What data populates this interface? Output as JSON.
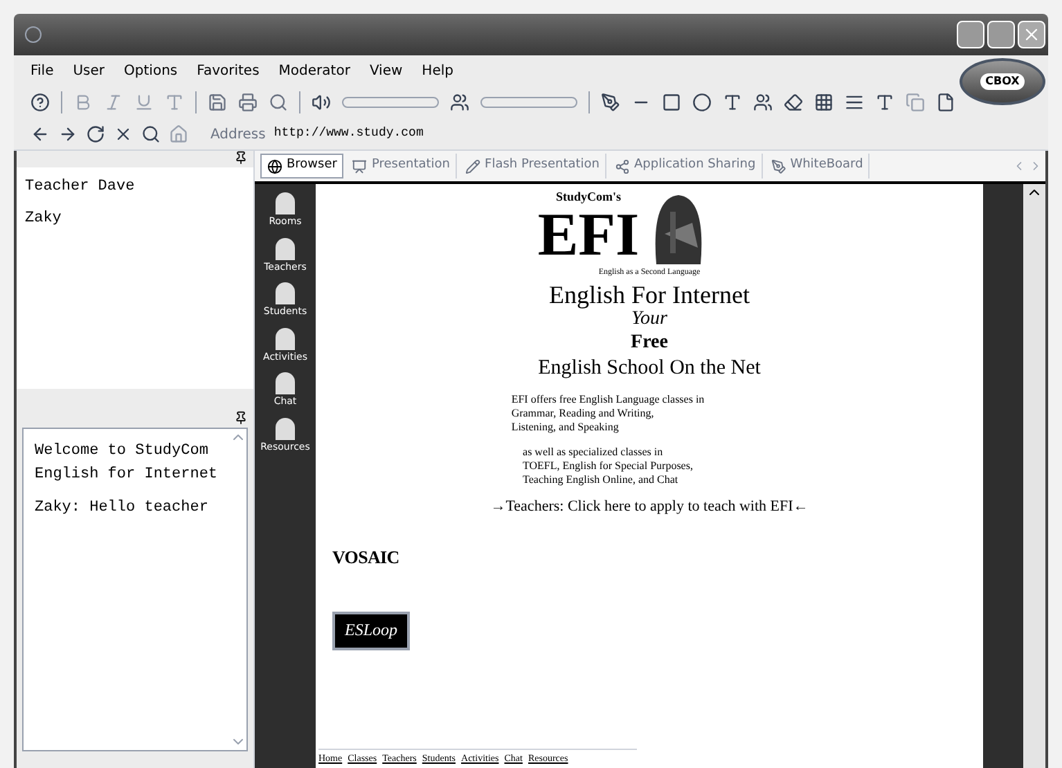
{
  "menu": [
    "File",
    "User",
    "Options",
    "Favorites",
    "Moderator",
    "View",
    "Help"
  ],
  "logo": "CBOX",
  "address": {
    "label": "Address",
    "value": "http://www.study.com"
  },
  "users": [
    "Teacher Dave",
    "Zaky"
  ],
  "chat": [
    "Welcome to StudyCom English for Internet",
    "Zaky: Hello teacher"
  ],
  "tabs": [
    {
      "label": "Browser",
      "selected": true
    },
    {
      "label": "Presentation",
      "selected": false
    },
    {
      "label": "Flash Presentation",
      "selected": false
    },
    {
      "label": "Application Sharing",
      "selected": false
    },
    {
      "label": "WhiteBoard",
      "selected": false
    }
  ],
  "site_nav": [
    "Rooms",
    "Teachers",
    "Students",
    "Activities",
    "Chat",
    "Resources"
  ],
  "page": {
    "brand": "StudyCom's",
    "title": "EFI",
    "subtitle": "English as a Second Language",
    "heading": "English For Internet",
    "your": "Your",
    "free": "Free",
    "tagline": "English School On the Net",
    "paras": [
      [
        "EFI offers free English Language classes in",
        "Grammar, Reading and Writing,",
        "Listening, and Speaking"
      ],
      [
        "as well as specialized classes in",
        "TOEFL, English for Special Purposes,",
        "Teaching English Online, and Chat"
      ]
    ],
    "teachers_link": "→Teachers: Click here to apply to teach with EFI←",
    "logo1": "VOSAIC",
    "logo2": "ESLoop",
    "footer": [
      "Home",
      "Classes",
      "Teachers",
      "Students",
      "Activities",
      "Chat",
      "Resources"
    ]
  }
}
